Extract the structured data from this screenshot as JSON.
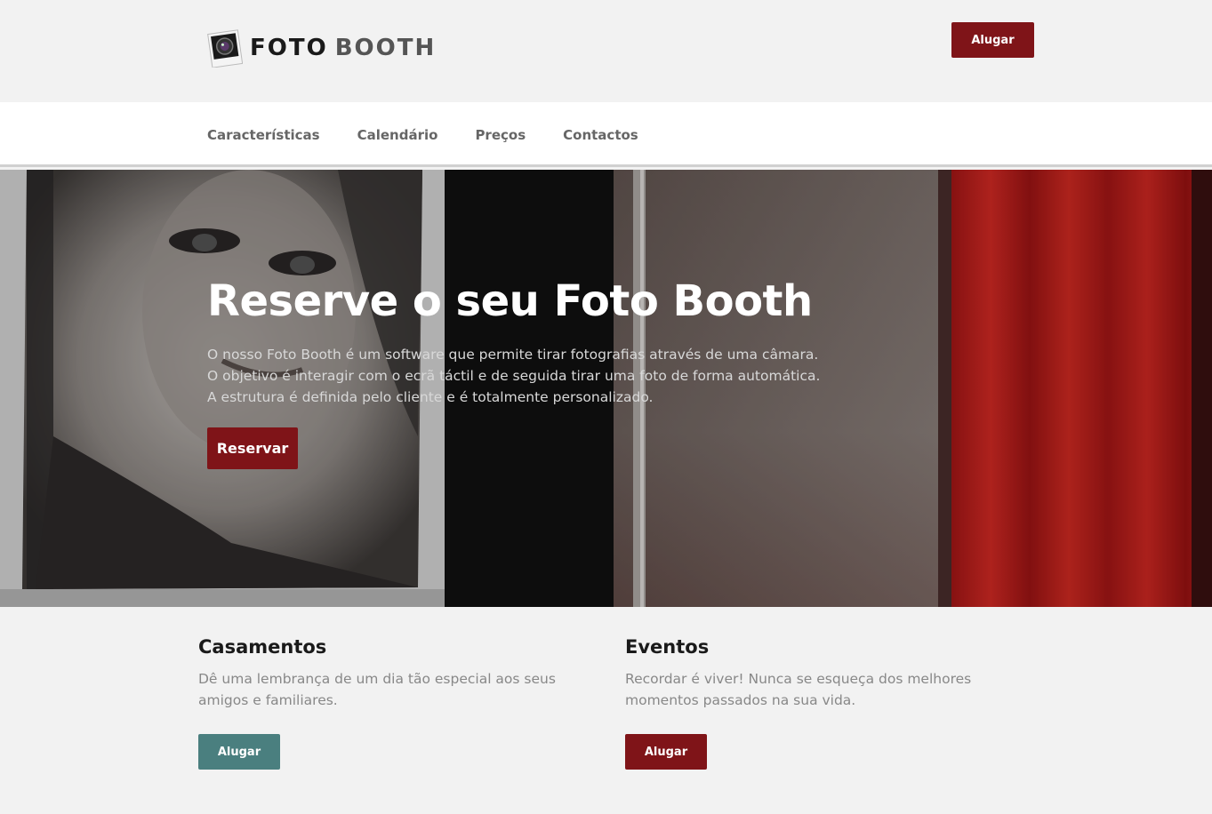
{
  "brand": {
    "word1": "FOTO",
    "word2": "BOOTH"
  },
  "header": {
    "rent_label": "Alugar"
  },
  "nav": {
    "items": [
      {
        "label": "Características"
      },
      {
        "label": "Calendário"
      },
      {
        "label": "Preços"
      },
      {
        "label": "Contactos"
      }
    ]
  },
  "hero": {
    "title": "Reserve o seu Foto Booth",
    "text": "O nosso Foto Booth é um software que permite tirar fotografias através de uma câmara. O objetivo é interagir com o ecrã táctil e de seguida tirar uma foto de forma automática. A estrutura é definida pelo cliente e é totalmente personalizado.",
    "button_label": "Reservar"
  },
  "features": [
    {
      "title": "Casamentos",
      "text": "Dê uma lembrança de um dia tão especial aos seus amigos e familiares.",
      "button_label": "Alugar",
      "button_color": "#4a7f7f"
    },
    {
      "title": "Eventos",
      "text": "Recordar é viver! Nunca se esqueça dos melhores momentos passados na sua vida.",
      "button_label": "Alugar",
      "button_color": "#7f1418"
    }
  ],
  "colors": {
    "accent_red": "#7f1418",
    "accent_teal": "#4a7f7f",
    "background": "#f2f2f2"
  },
  "icons": {
    "logo": "camera-photo-icon"
  }
}
